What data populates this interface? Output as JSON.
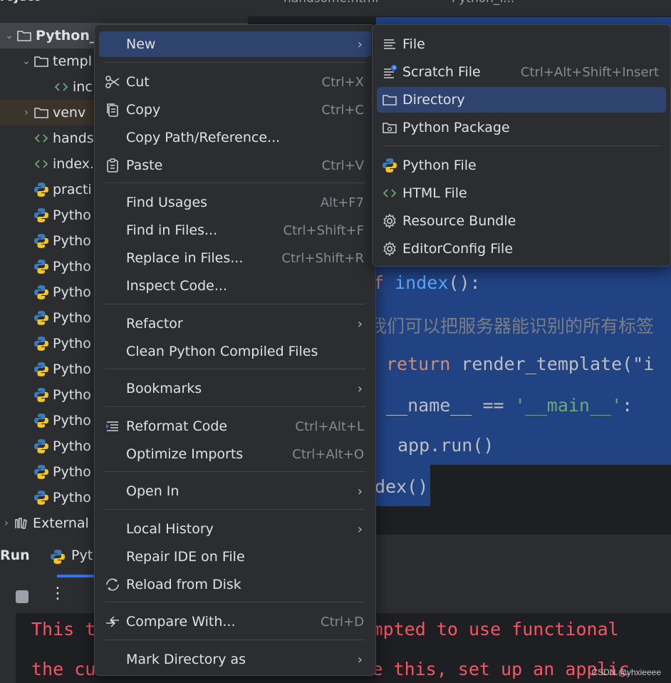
{
  "project_panel": {
    "title": "roject",
    "items": [
      {
        "label": "Python_",
        "icon": "folder-icon",
        "chevron": "expanded"
      },
      {
        "label": "templ",
        "icon": "folder-icon",
        "chevron": "expanded"
      },
      {
        "label": "inc",
        "icon": "html-file-icon",
        "chevron": "none"
      },
      {
        "label": "venv",
        "icon": "folder-icon",
        "chevron": "collapsed"
      },
      {
        "label": "hands",
        "icon": "html-file-icon",
        "chevron": "none"
      },
      {
        "label": "index.",
        "icon": "html-file-icon",
        "chevron": "none"
      },
      {
        "label": "practi",
        "icon": "python-icon",
        "chevron": "none"
      },
      {
        "label": "Pytho",
        "icon": "python-icon",
        "chevron": "none"
      },
      {
        "label": "Pytho",
        "icon": "python-icon",
        "chevron": "none"
      },
      {
        "label": "Pytho",
        "icon": "python-icon",
        "chevron": "none"
      },
      {
        "label": "Pytho",
        "icon": "python-icon",
        "chevron": "none"
      },
      {
        "label": "Pytho",
        "icon": "python-icon",
        "chevron": "none"
      },
      {
        "label": "Pytho",
        "icon": "python-icon",
        "chevron": "none"
      },
      {
        "label": "Pytho",
        "icon": "python-icon",
        "chevron": "none"
      },
      {
        "label": "Pytho",
        "icon": "python-icon",
        "chevron": "none"
      },
      {
        "label": "Pytho",
        "icon": "python-icon",
        "chevron": "none"
      },
      {
        "label": "Pytho",
        "icon": "python-icon",
        "chevron": "none"
      },
      {
        "label": "Pytho",
        "icon": "python-icon",
        "chevron": "none"
      },
      {
        "label": "Pytho",
        "icon": "python-icon",
        "chevron": "none"
      },
      {
        "label": "External",
        "icon": "library-icon",
        "chevron": "collapsed"
      }
    ]
  },
  "editor": {
    "tabs": [
      "handsome.html",
      "Python_f..."
    ],
    "lines": {
      "def_kw": "f",
      "def_name": "index",
      "def_rest": "():",
      "comment": "我们可以把服务器能识别的所有标签",
      "return_kw": "return",
      "return_rest": " render_template(\"i",
      "if_name": "__name__ == ",
      "if_main": "'__main__'",
      "if_colon": ":",
      "app_run": "app.run()",
      "index_call": "dex()"
    }
  },
  "run_panel": {
    "tab_run": "Run",
    "tab_file": "Pyt",
    "console_line1_left": "This t",
    "console_line1_right": "attempted to use functional",
    "console_line2_left": "the cu",
    "console_line2_right": "lve this, set up an applic"
  },
  "watermark": "CSDN @yhxieeee",
  "context_menu": {
    "items": [
      {
        "label": "New",
        "shortcut": "",
        "submenu": true,
        "icon": "",
        "active": true
      },
      {
        "label": "Cut",
        "shortcut": "Ctrl+X",
        "submenu": false,
        "icon": "scissors-icon"
      },
      {
        "label": "Copy",
        "shortcut": "Ctrl+C",
        "submenu": false,
        "icon": "copy-icon"
      },
      {
        "label": "Copy Path/Reference...",
        "shortcut": "",
        "submenu": false,
        "icon": ""
      },
      {
        "label": "Paste",
        "shortcut": "Ctrl+V",
        "submenu": false,
        "icon": "paste-icon"
      },
      {
        "label": "Find Usages",
        "shortcut": "Alt+F7",
        "submenu": false,
        "icon": ""
      },
      {
        "label": "Find in Files...",
        "shortcut": "Ctrl+Shift+F",
        "submenu": false,
        "icon": ""
      },
      {
        "label": "Replace in Files...",
        "shortcut": "Ctrl+Shift+R",
        "submenu": false,
        "icon": ""
      },
      {
        "label": "Inspect Code...",
        "shortcut": "",
        "submenu": false,
        "icon": ""
      },
      {
        "label": "Refactor",
        "shortcut": "",
        "submenu": true,
        "icon": ""
      },
      {
        "label": "Clean Python Compiled Files",
        "shortcut": "",
        "submenu": false,
        "icon": ""
      },
      {
        "label": "Bookmarks",
        "shortcut": "",
        "submenu": true,
        "icon": ""
      },
      {
        "label": "Reformat Code",
        "shortcut": "Ctrl+Alt+L",
        "submenu": false,
        "icon": "reformat-icon"
      },
      {
        "label": "Optimize Imports",
        "shortcut": "Ctrl+Alt+O",
        "submenu": false,
        "icon": ""
      },
      {
        "label": "Open In",
        "shortcut": "",
        "submenu": true,
        "icon": ""
      },
      {
        "label": "Local History",
        "shortcut": "",
        "submenu": true,
        "icon": ""
      },
      {
        "label": "Repair IDE on File",
        "shortcut": "",
        "submenu": false,
        "icon": ""
      },
      {
        "label": "Reload from Disk",
        "shortcut": "",
        "submenu": false,
        "icon": "reload-icon"
      },
      {
        "label": "Compare With...",
        "shortcut": "Ctrl+D",
        "submenu": false,
        "icon": "compare-icon"
      },
      {
        "label": "Mark Directory as",
        "shortcut": "",
        "submenu": true,
        "icon": ""
      }
    ]
  },
  "new_submenu": {
    "items": [
      {
        "label": "File",
        "shortcut": "",
        "icon": "file-icon"
      },
      {
        "label": "Scratch File",
        "shortcut": "Ctrl+Alt+Shift+Insert",
        "icon": "scratch-file-icon"
      },
      {
        "label": "Directory",
        "shortcut": "",
        "icon": "folder-icon",
        "active": true
      },
      {
        "label": "Python Package",
        "shortcut": "",
        "icon": "package-icon"
      },
      {
        "label": "Python File",
        "shortcut": "",
        "icon": "python-icon"
      },
      {
        "label": "HTML File",
        "shortcut": "",
        "icon": "html-file-icon"
      },
      {
        "label": "Resource Bundle",
        "shortcut": "",
        "icon": "gear-icon"
      },
      {
        "label": "EditorConfig File",
        "shortcut": "",
        "icon": "gear-icon"
      }
    ]
  },
  "colors": {
    "menu_bg": "#2b2d30",
    "menu_active": "#2e436e",
    "selection": "#214283",
    "error_text": "#f75464"
  }
}
